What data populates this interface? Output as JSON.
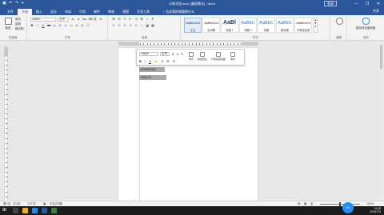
{
  "titlebar": {
    "title": "示例文档.docx [兼容模式] - Word",
    "login_label": "登录",
    "qa_icons": [
      "save-icon",
      "undo-icon",
      "redo-icon",
      "customize-icon"
    ],
    "window_buttons": [
      "—",
      "❐",
      "✕"
    ]
  },
  "tabs": {
    "items": [
      "文件",
      "开始",
      "插入",
      "设计",
      "布局",
      "引用",
      "邮件",
      "审阅",
      "视图",
      "开发工具"
    ],
    "active_index": 1,
    "tell_me": "♀ 告诉我你想要做什么",
    "share": "共享"
  },
  "ribbon": {
    "clipboard": {
      "paste": "粘贴",
      "cut": "剪切",
      "copy": "复制",
      "format_painter": "格式刷",
      "label": "剪贴板"
    },
    "font": {
      "name": "Calibri",
      "size": "五号",
      "label": "字体"
    },
    "paragraph": {
      "label": "段落"
    },
    "styles": {
      "items": [
        {
          "preview": "AaBbCcDd",
          "name": "正文",
          "kind": "normal"
        },
        {
          "preview": "AaBbCcDd",
          "name": "无间隔",
          "kind": "normal"
        },
        {
          "preview": "AaBl",
          "name": "标题 1",
          "kind": "big"
        },
        {
          "preview": "AaBbC",
          "name": "标题 2",
          "kind": "mid"
        },
        {
          "preview": "AaBbC",
          "name": "标题",
          "kind": "mid"
        },
        {
          "preview": "AaBbC",
          "name": "副标题",
          "kind": "mid"
        },
        {
          "preview": "AaBbCcDd",
          "name": "不明显强调",
          "kind": "normal"
        },
        {
          "preview": "AaBbCcDd",
          "name": "强调",
          "kind": "normal"
        }
      ],
      "label": "样式"
    },
    "editing": {
      "label": "编辑"
    },
    "save": {
      "button": "保存到百度网盘",
      "label": "保存"
    }
  },
  "document": {
    "lines": [
      "1234567890",
      "7890123"
    ]
  },
  "minibar": {
    "font": "Calibri",
    "size": "五号",
    "styles_btn": "样式",
    "new_comment": "新建批注",
    "line_spacing": "行和段落间距",
    "center": "居中"
  },
  "statusbar": {
    "page": "第1页，共1页",
    "words": "13个字",
    "lang": "中文(中国)",
    "zoom": "100%"
  },
  "taskbar": {
    "time": "11:28",
    "date": "2024/7/3",
    "badge": "51"
  }
}
